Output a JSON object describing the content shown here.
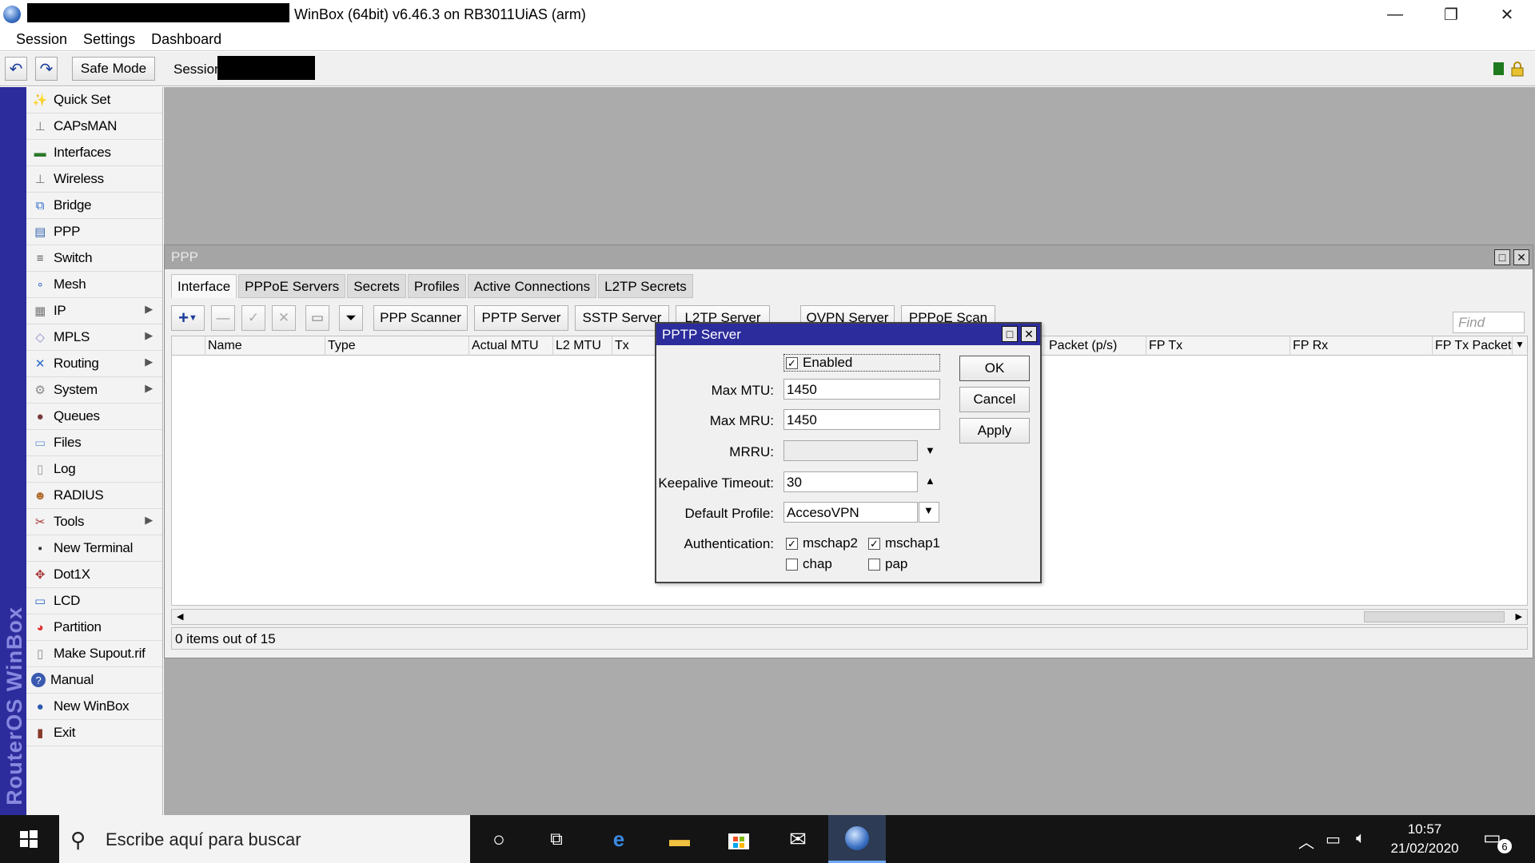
{
  "window": {
    "title": "WinBox (64bit) v6.46.3 on RB3011UiAS (arm)",
    "minimize": "—",
    "maximize": "❐",
    "close": "✕"
  },
  "menu": [
    "Session",
    "Settings",
    "Dashboard"
  ],
  "toolbar": {
    "undo_icon": "↶",
    "redo_icon": "↷",
    "safe_mode": "Safe Mode",
    "session_label": "Session"
  },
  "brand": "RouterOS WinBox",
  "sidebar": {
    "items": [
      {
        "label": "Quick Set",
        "icon": "quick-set-icon",
        "glyph": "✨",
        "submenu": false
      },
      {
        "label": "CAPsMAN",
        "icon": "antenna-icon",
        "glyph": "⊥",
        "submenu": false
      },
      {
        "label": "Interfaces",
        "icon": "interfaces-icon",
        "glyph": "▬",
        "submenu": false
      },
      {
        "label": "Wireless",
        "icon": "wireless-icon",
        "glyph": "⊥",
        "submenu": false
      },
      {
        "label": "Bridge",
        "icon": "bridge-icon",
        "glyph": "⧉",
        "submenu": false
      },
      {
        "label": "PPP",
        "icon": "ppp-icon",
        "glyph": "▤",
        "submenu": false
      },
      {
        "label": "Switch",
        "icon": "switch-icon",
        "glyph": "≡",
        "submenu": false
      },
      {
        "label": "Mesh",
        "icon": "mesh-icon",
        "glyph": "∘",
        "submenu": false
      },
      {
        "label": "IP",
        "icon": "ip-icon",
        "glyph": "▦",
        "submenu": true
      },
      {
        "label": "MPLS",
        "icon": "mpls-icon",
        "glyph": "◇",
        "submenu": true
      },
      {
        "label": "Routing",
        "icon": "routing-icon",
        "glyph": "✕",
        "submenu": true
      },
      {
        "label": "System",
        "icon": "system-gear-icon",
        "glyph": "⚙",
        "submenu": true
      },
      {
        "label": "Queues",
        "icon": "queues-icon",
        "glyph": "●",
        "submenu": false
      },
      {
        "label": "Files",
        "icon": "files-folder-icon",
        "glyph": "▭",
        "submenu": false
      },
      {
        "label": "Log",
        "icon": "log-document-icon",
        "glyph": "▯",
        "submenu": false
      },
      {
        "label": "RADIUS",
        "icon": "radius-users-icon",
        "glyph": "☻",
        "submenu": false
      },
      {
        "label": "Tools",
        "icon": "tools-icon",
        "glyph": "✂",
        "submenu": true
      },
      {
        "label": "New Terminal",
        "icon": "terminal-icon",
        "glyph": "▪",
        "submenu": false
      },
      {
        "label": "Dot1X",
        "icon": "dot1x-icon",
        "glyph": "✥",
        "submenu": false
      },
      {
        "label": "LCD",
        "icon": "lcd-monitor-icon",
        "glyph": "▭",
        "submenu": false
      },
      {
        "label": "Partition",
        "icon": "partition-pie-icon",
        "glyph": "◕",
        "submenu": false
      },
      {
        "label": "Make Supout.rif",
        "icon": "supout-file-icon",
        "glyph": "▯",
        "submenu": false
      },
      {
        "label": "Manual",
        "icon": "manual-help-icon",
        "glyph": "?",
        "submenu": false
      },
      {
        "label": "New WinBox",
        "icon": "winbox-globe-icon",
        "glyph": "●",
        "submenu": false
      },
      {
        "label": "Exit",
        "icon": "exit-door-icon",
        "glyph": "▮",
        "submenu": false
      }
    ]
  },
  "ppp_window": {
    "title": "PPP",
    "tabs": [
      "Interface",
      "PPPoE Servers",
      "Secrets",
      "Profiles",
      "Active Connections",
      "L2TP Secrets"
    ],
    "buttons": {
      "pppscanner": "PPP Scanner",
      "pptpserver": "PPTP Server",
      "sstpserver": "SSTP Server",
      "l2tpserver": "L2TP Server",
      "ovpnserver": "OVPN Server",
      "pppoescan": "PPPoE Scan"
    },
    "find_placeholder": "Find",
    "columns": [
      "Name",
      "Type",
      "Actual MTU",
      "L2 MTU",
      "Tx",
      "Packet (p/s)",
      "FP Tx",
      "FP Rx",
      "FP Tx Packet"
    ],
    "status": "0 items out of 15"
  },
  "pptp_dialog": {
    "title": "PPTP Server",
    "enabled_label": "Enabled",
    "enabled": true,
    "max_mtu_label": "Max MTU:",
    "max_mtu": "1450",
    "max_mru_label": "Max MRU:",
    "max_mru": "1450",
    "mrru_label": "MRRU:",
    "mrru": "",
    "keepalive_label": "Keepalive Timeout:",
    "keepalive": "30",
    "profile_label": "Default Profile:",
    "profile": "AccesoVPN",
    "auth_label": "Authentication:",
    "auth": {
      "mschap2": {
        "label": "mschap2",
        "checked": true
      },
      "mschap1": {
        "label": "mschap1",
        "checked": true
      },
      "chap": {
        "label": "chap",
        "checked": false
      },
      "pap": {
        "label": "pap",
        "checked": false
      }
    },
    "ok": "OK",
    "cancel": "Cancel",
    "apply": "Apply"
  },
  "taskbar": {
    "search_placeholder": "Escribe aquí para buscar",
    "time": "10:57",
    "date": "21/02/2020",
    "notifications": "6"
  }
}
